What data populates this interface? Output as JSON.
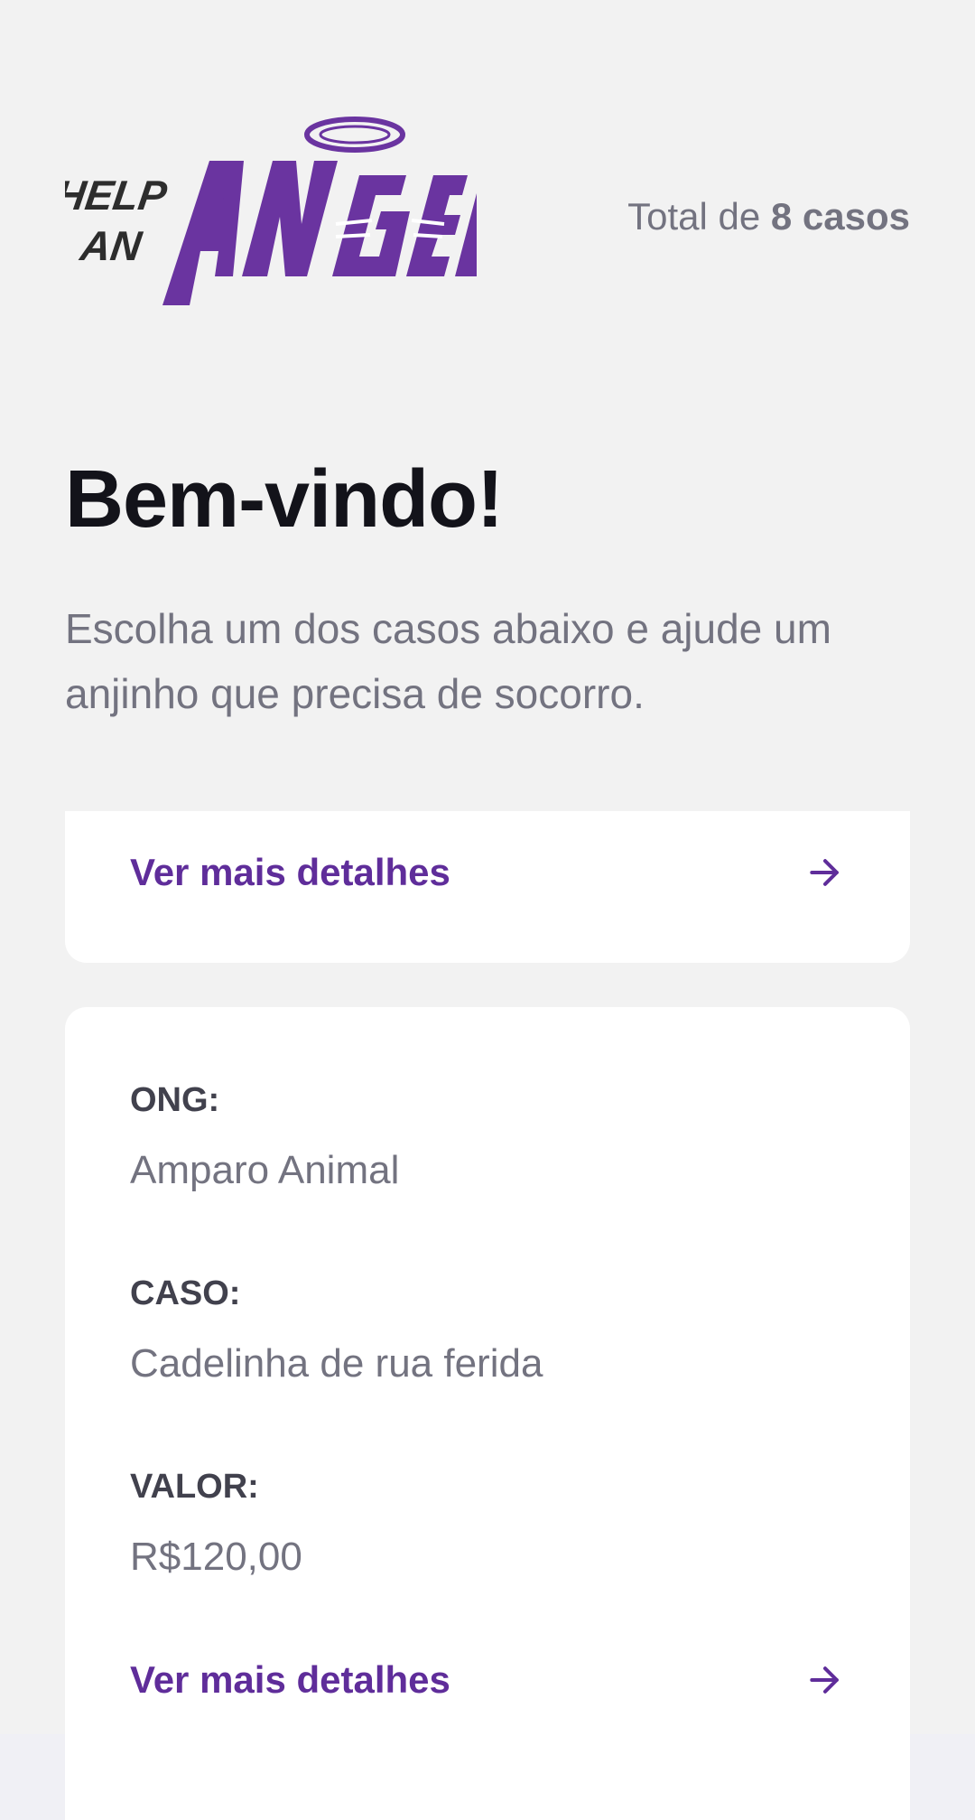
{
  "header": {
    "logo_text": [
      "HELP",
      "AN",
      "ANGEL"
    ],
    "total_prefix": "Total de",
    "total_count": "8 casos"
  },
  "welcome": {
    "title": "Bem-vindo!",
    "subtitle": "Escolha um dos casos abaixo e ajude um anjinho que precisa de socorro."
  },
  "cases": [
    {
      "details_label": "Ver mais detalhes",
      "icon": "arrow-right-icon"
    },
    {
      "ong_label": "ONG:",
      "ong": "Amparo Animal",
      "caso_label": "CASO:",
      "caso": "Cadelinha de rua ferida",
      "valor_label": "VALOR:",
      "valor": "R$120,00",
      "details_label": "Ver mais detalhes",
      "icon": "arrow-right-icon"
    }
  ],
  "colors": {
    "background": "#f2f2f2",
    "brand": "#5f2d9a",
    "title": "#13131a",
    "muted": "#737380",
    "label": "#41414d",
    "card": "#ffffff"
  }
}
